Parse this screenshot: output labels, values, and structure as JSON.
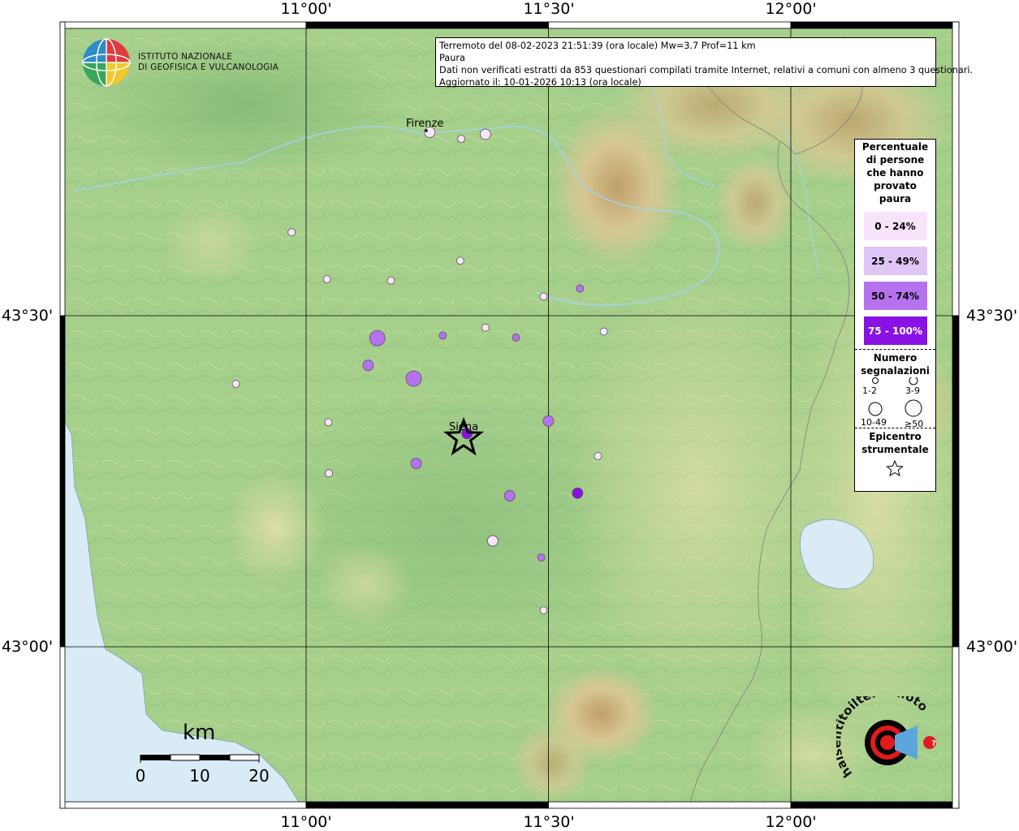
{
  "frame": {
    "lon_labels": [
      "11°00'",
      "11°30'",
      "12°00'"
    ],
    "lat_labels": [
      "43°30'",
      "43°00'"
    ]
  },
  "logo": {
    "line1": "ISTITUTO NAZIONALE",
    "line2": "DI GEOFISICA E VULCANOLOGIA",
    "corner_logo_text": "haisentitoilterremoto.it www."
  },
  "info": {
    "line1": "Terremoto del 08-02-2023 21:51:39 (ora locale) Mw=3.7 Prof=11 km",
    "line2": "Paura",
    "line3": "Dati non verificati estratti da 853 questionari compilati tramite Internet, relativi a comuni con almeno 3 questionari.",
    "line4": "Aggiornato il: 10-01-2026 10:13 (ora locale)"
  },
  "places": {
    "firenze": "Firenze",
    "siena": "Siena"
  },
  "legend": {
    "title_lines": [
      "Percentuale",
      "di persone",
      "che hanno",
      "provato",
      "paura"
    ],
    "classes": [
      {
        "label": "0 - 24%",
        "color": "#f7e4fb"
      },
      {
        "label": "25 - 49%",
        "color": "#e0c6f6"
      },
      {
        "label": "50 - 74%",
        "color": "#b671ee"
      },
      {
        "label": "75 - 100%",
        "color": "#8a11e6"
      }
    ],
    "size_title_lines": [
      "Numero",
      "segnalazioni"
    ],
    "size_labels": [
      "1-2",
      "3-9",
      "10-49",
      "≥50"
    ],
    "epicenter_title_lines": [
      "Epicentro",
      "strumentale"
    ]
  },
  "scale": {
    "unit": "km",
    "labels": [
      "0",
      "10",
      "20"
    ]
  },
  "points": [
    {
      "lon": 11.37,
      "lat": 43.774,
      "cls": 0,
      "size": 2
    },
    {
      "lon": 11.255,
      "lat": 43.777,
      "cls": 0,
      "size": 2
    },
    {
      "lon": 11.32,
      "lat": 43.767,
      "cls": 0,
      "size": 1
    },
    {
      "lon": 10.97,
      "lat": 43.626,
      "cls": 0,
      "size": 1
    },
    {
      "lon": 11.318,
      "lat": 43.583,
      "cls": 0,
      "size": 1
    },
    {
      "lon": 11.043,
      "lat": 43.555,
      "cls": 0,
      "size": 1
    },
    {
      "lon": 11.175,
      "lat": 43.553,
      "cls": 0,
      "size": 1
    },
    {
      "lon": 11.49,
      "lat": 43.529,
      "cls": 0,
      "size": 1
    },
    {
      "lon": 11.565,
      "lat": 43.541,
      "cls": 2,
      "size": 1
    },
    {
      "lon": 11.614,
      "lat": 43.476,
      "cls": 0,
      "size": 1
    },
    {
      "lon": 11.37,
      "lat": 43.482,
      "cls": 0,
      "size": 1
    },
    {
      "lon": 11.147,
      "lat": 43.466,
      "cls": 2,
      "size": 3
    },
    {
      "lon": 11.282,
      "lat": 43.47,
      "cls": 2,
      "size": 1
    },
    {
      "lon": 11.433,
      "lat": 43.467,
      "cls": 2,
      "size": 1
    },
    {
      "lon": 10.855,
      "lat": 43.397,
      "cls": 0,
      "size": 1
    },
    {
      "lon": 11.128,
      "lat": 43.425,
      "cls": 2,
      "size": 2
    },
    {
      "lon": 11.222,
      "lat": 43.405,
      "cls": 2,
      "size": 3
    },
    {
      "lon": 11.046,
      "lat": 43.339,
      "cls": 0,
      "size": 1
    },
    {
      "lon": 11.5,
      "lat": 43.341,
      "cls": 2,
      "size": 2
    },
    {
      "lon": 11.332,
      "lat": 43.322,
      "cls": 3,
      "size": 2
    },
    {
      "lon": 11.602,
      "lat": 43.288,
      "cls": 0,
      "size": 1
    },
    {
      "lon": 11.047,
      "lat": 43.262,
      "cls": 0,
      "size": 1
    },
    {
      "lon": 11.227,
      "lat": 43.277,
      "cls": 2,
      "size": 2
    },
    {
      "lon": 11.42,
      "lat": 43.228,
      "cls": 2,
      "size": 2
    },
    {
      "lon": 11.56,
      "lat": 43.232,
      "cls": 3,
      "size": 2
    },
    {
      "lon": 11.385,
      "lat": 43.16,
      "cls": 0,
      "size": 2
    },
    {
      "lon": 11.485,
      "lat": 43.135,
      "cls": 2,
      "size": 1
    },
    {
      "lon": 11.49,
      "lat": 43.055,
      "cls": 0,
      "size": 1
    }
  ],
  "epicenter": {
    "lon": 11.325,
    "lat": 43.315
  }
}
